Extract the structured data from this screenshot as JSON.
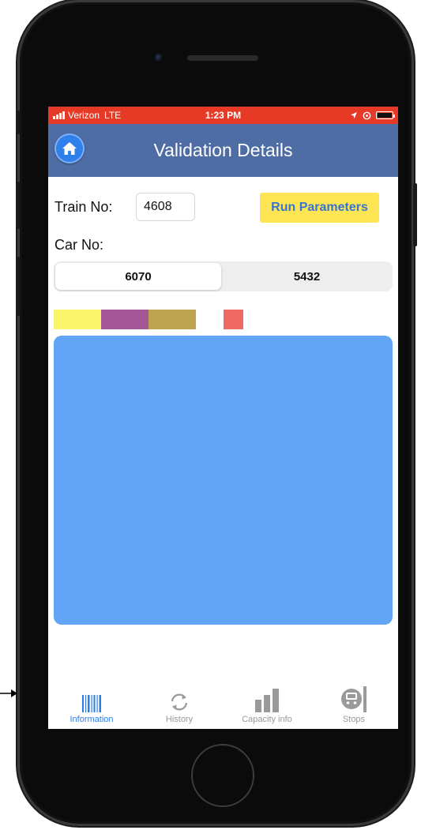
{
  "status_bar": {
    "carrier": "Verizon",
    "network": "LTE",
    "time": "1:23 PM"
  },
  "nav": {
    "title": "Validation Details",
    "home_icon": "home-icon"
  },
  "form": {
    "train_label": "Train No:",
    "train_value": "4608",
    "run_button": "Run Parameters",
    "car_label": "Car No:"
  },
  "car_segments": [
    {
      "label": "6070",
      "selected": true
    },
    {
      "label": "5432",
      "selected": false
    }
  ],
  "swatch_colors": [
    "#f9f66c",
    "#a55697",
    "#bca34f",
    "#ee6a62"
  ],
  "content_color": "#62a4f6",
  "tabs": [
    {
      "label": "Information",
      "icon": "barcode-icon",
      "active": true
    },
    {
      "label": "History",
      "icon": "refresh-icon",
      "active": false
    },
    {
      "label": "Capacity info",
      "icon": "bar-chart-icon",
      "active": false
    },
    {
      "label": "Stops",
      "icon": "train-icon",
      "active": false
    }
  ],
  "colors": {
    "status_bar": "#e63a26",
    "nav_bar": "#4f6da5",
    "run_button_bg": "#fde554",
    "run_button_text": "#3975d0",
    "tab_active": "#2d7de6",
    "tab_inactive": "#9a9a9a"
  }
}
